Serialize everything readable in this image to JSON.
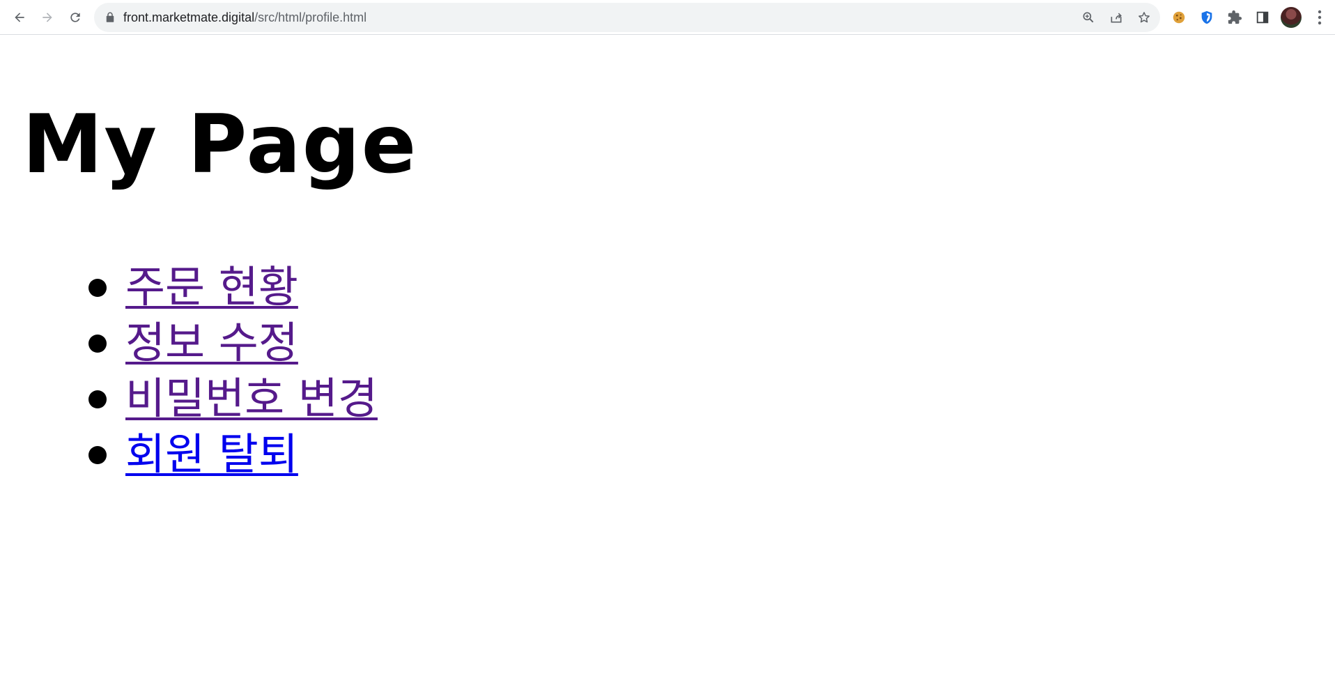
{
  "browser": {
    "url_host": "front.marketmate.digital",
    "url_path": "/src/html/profile.html",
    "icons": {
      "back": "arrow-left-icon",
      "forward": "arrow-right-icon",
      "reload": "reload-icon",
      "lock": "lock-icon",
      "zoom": "zoom-icon",
      "share": "share-icon",
      "bookmark": "star-icon",
      "extensions": [
        "cookie-extension-icon",
        "shield-extension-icon",
        "puzzle-extensions-icon",
        "side-panel-icon"
      ],
      "profile": "avatar",
      "menu": "kebab-menu-icon"
    }
  },
  "page": {
    "title": "My Page",
    "menu": [
      {
        "label": "주문 현황",
        "visited": true
      },
      {
        "label": "정보 수정",
        "visited": true
      },
      {
        "label": "비밀번호 변경",
        "visited": true
      },
      {
        "label": "회원 탈퇴",
        "visited": false
      }
    ]
  },
  "colors": {
    "visited_link": "#551a8b",
    "unvisited_link": "#0000ee",
    "omnibox_bg": "#f1f3f4",
    "shield_ext": "#1a73e8"
  }
}
